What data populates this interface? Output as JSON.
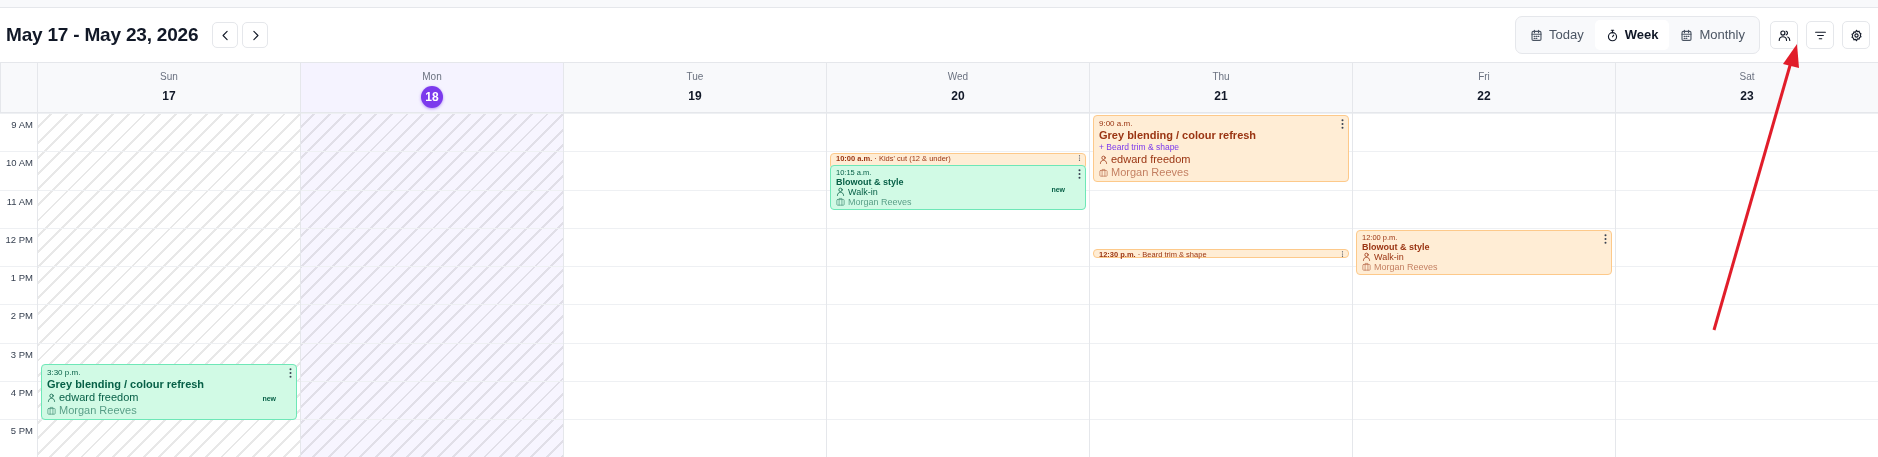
{
  "header": {
    "title": "May 17 - May 23, 2026",
    "views": [
      {
        "label": "Today",
        "selected": false,
        "kind": "calendar"
      },
      {
        "label": "Week",
        "selected": true,
        "kind": "timer"
      },
      {
        "label": "Monthly",
        "selected": false,
        "kind": "calendar"
      }
    ]
  },
  "hours": [
    "9 AM",
    "10 AM",
    "11 AM",
    "12 PM",
    "1 PM",
    "2 PM",
    "3 PM",
    "4 PM",
    "5 PM"
  ],
  "days": [
    {
      "name": "Sun",
      "date": "17",
      "today": false,
      "past": true,
      "events": [
        {
          "kind": "full",
          "color": "#d1fae5",
          "time": "3:30 p.m.",
          "title": "Grey blending / colour refresh",
          "client": "edward freedom",
          "staff": "Morgan Reeves",
          "tag": "new"
        }
      ]
    },
    {
      "name": "Mon",
      "date": "18",
      "today": true,
      "past": true
    },
    {
      "name": "Tue",
      "date": "19",
      "today": false,
      "past": false
    },
    {
      "name": "Wed",
      "date": "20",
      "today": false,
      "past": false,
      "events": [
        {
          "kind": "compact",
          "color": "#ffedd5",
          "time": "10:00 a.m.",
          "separator": "·",
          "title": "Kids' cut (12 & under)"
        },
        {
          "kind": "full",
          "color": "#d1fae5",
          "time": "10:15 a.m.",
          "title": "Blowout & style",
          "client": "Walk-in",
          "staff": "Morgan Reeves",
          "tag": "new"
        }
      ]
    },
    {
      "name": "Thu",
      "date": "21",
      "today": false,
      "past": false,
      "events": [
        {
          "kind": "full",
          "color": "#ffedd5",
          "time": "9:00 a.m.",
          "title": "Grey blending / colour refresh",
          "extra": "+ Beard trim & shape",
          "client": "edward freedom",
          "staff": "Morgan Reeves"
        },
        {
          "kind": "compact",
          "color": "#ffedd5",
          "time": "12:30 p.m.",
          "separator": "·",
          "title": "Beard trim & shape"
        }
      ]
    },
    {
      "name": "Fri",
      "date": "22",
      "today": false,
      "past": false,
      "events": [
        {
          "kind": "full",
          "color": "#ffedd5",
          "time": "12:00 p.m.",
          "title": "Blowout & style",
          "client": "Walk-in",
          "staff": "Morgan Reeves"
        }
      ]
    },
    {
      "name": "Sat",
      "date": "23",
      "today": false,
      "past": false
    }
  ]
}
